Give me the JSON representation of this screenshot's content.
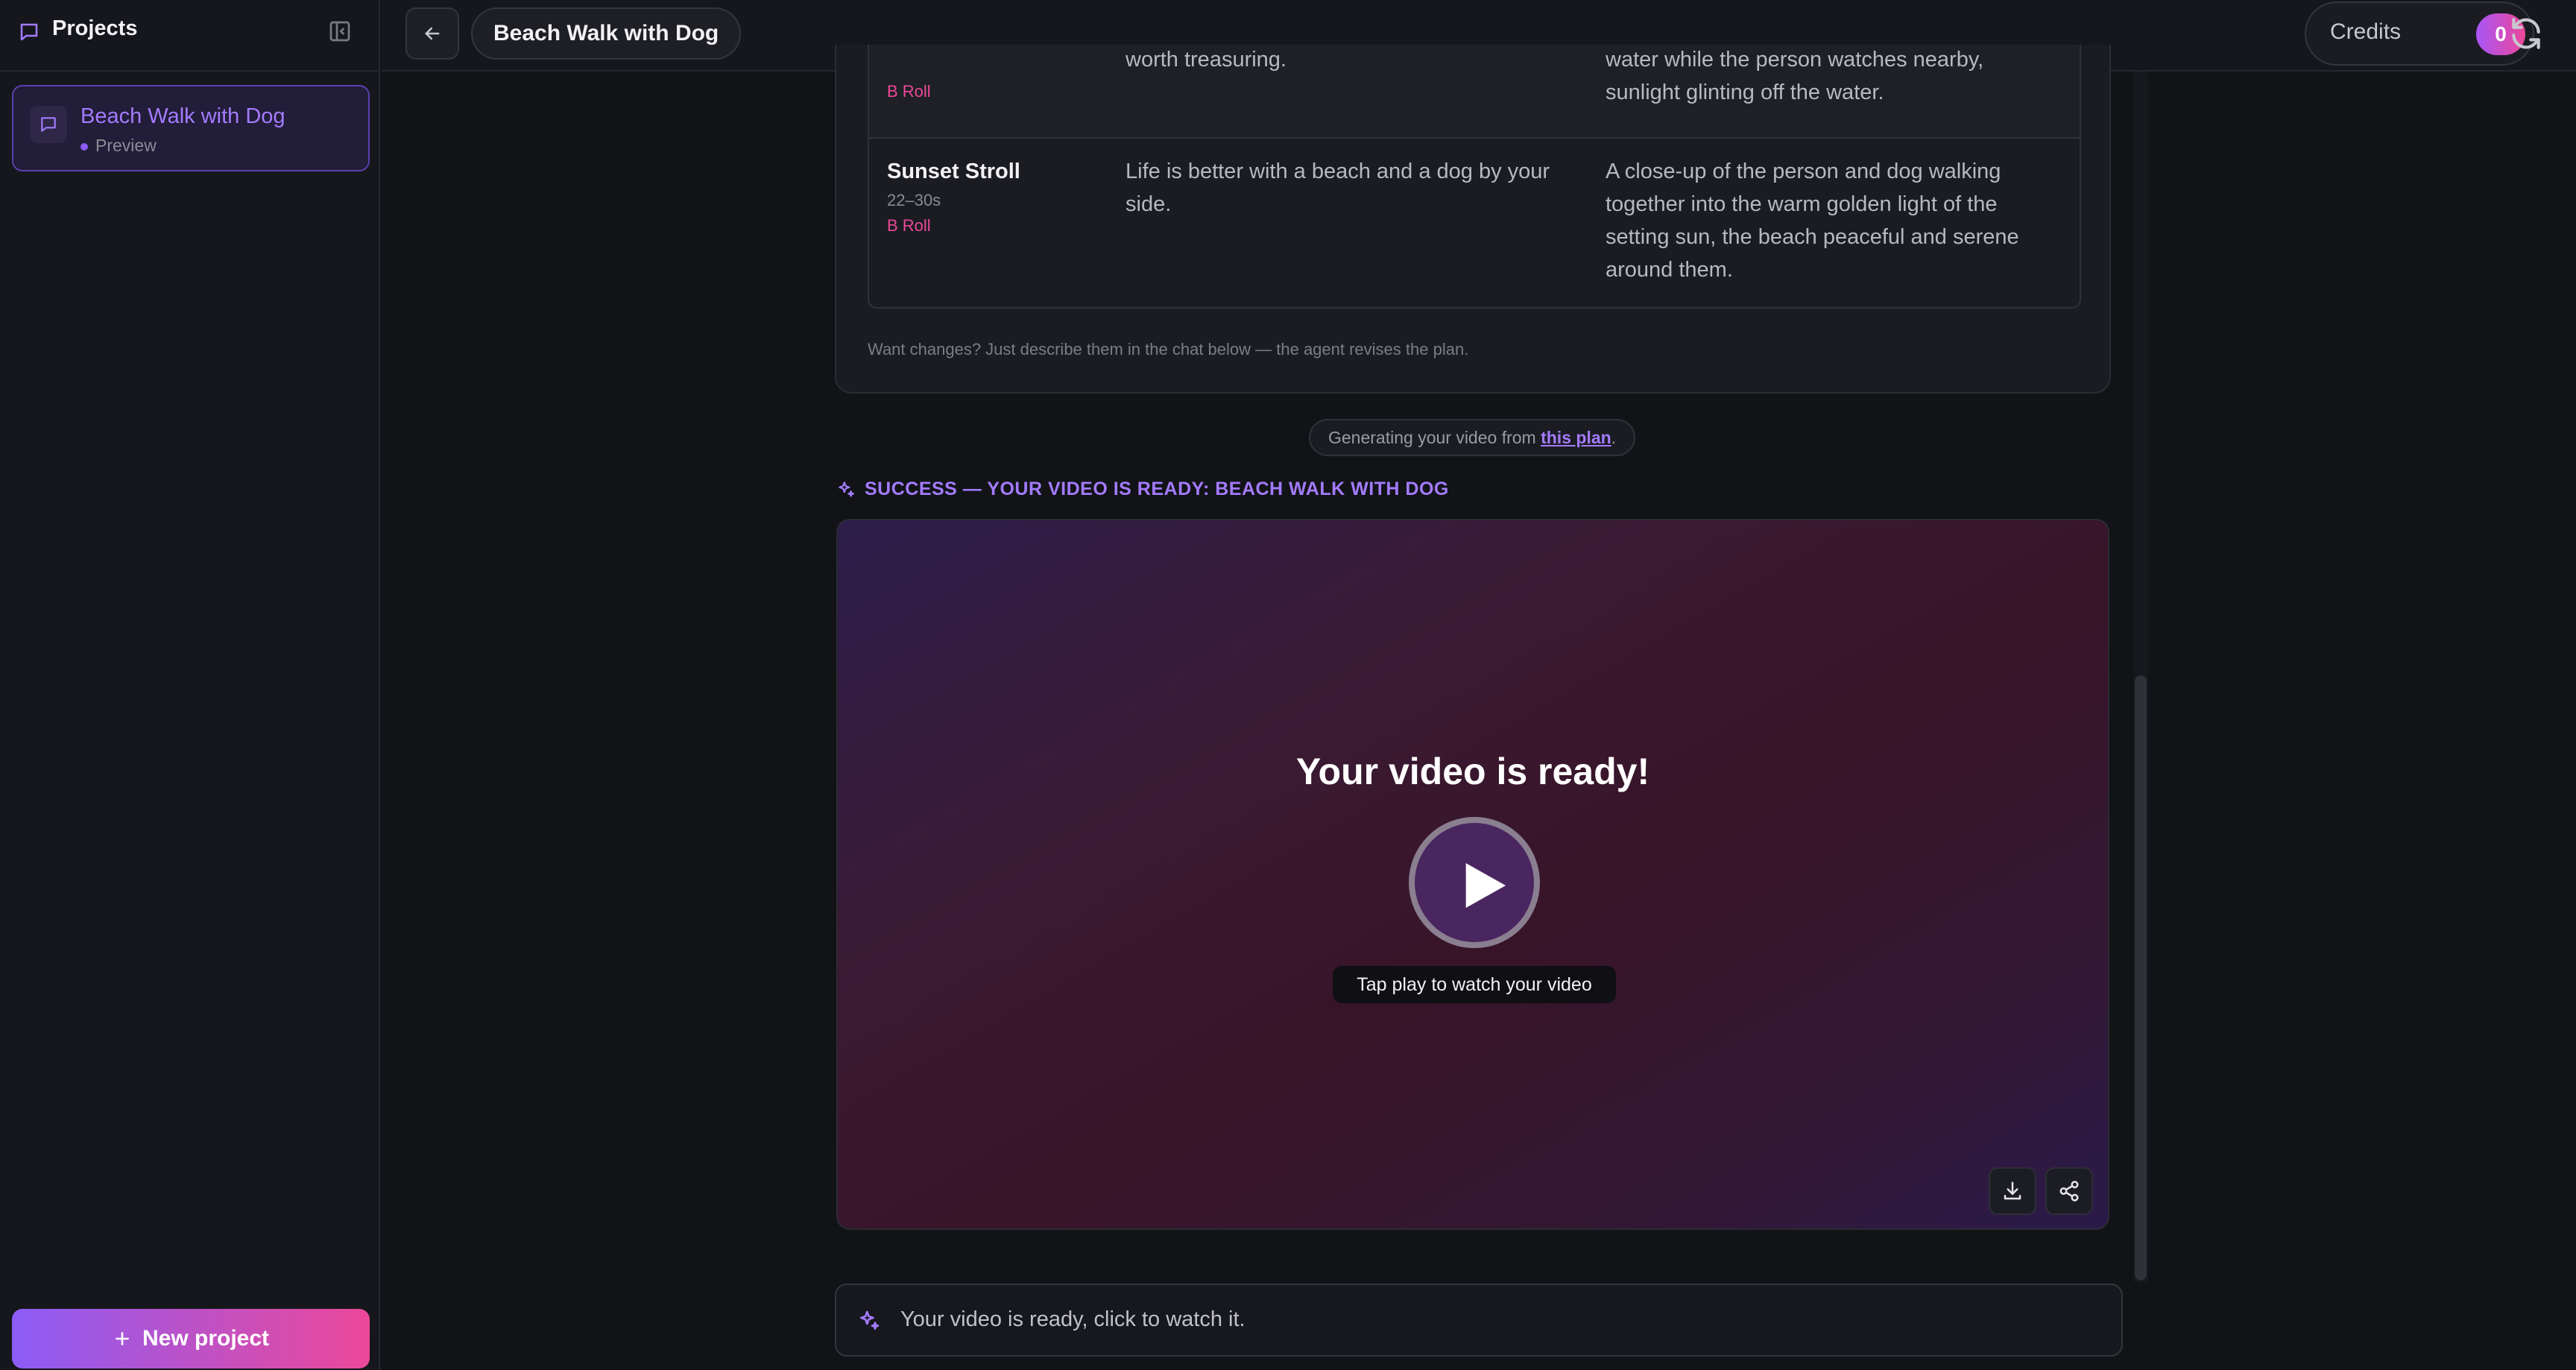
{
  "sidebar": {
    "title": "Projects",
    "project": {
      "title": "Beach Walk with Dog",
      "status": "Preview"
    },
    "new_project_label": "New project"
  },
  "topbar": {
    "project_title": "Beach Walk with Dog",
    "credits_label": "Credits",
    "credits_count": "0"
  },
  "plan": {
    "rows": [
      {
        "type": "B Roll",
        "line": "worth treasuring.",
        "visual_line1": "water while the person watches nearby,",
        "visual_line2": "sunlight glinting off the water."
      },
      {
        "name": "Sunset Stroll",
        "time": "22–30s",
        "type": "B Roll",
        "line": "Life is better with a beach and a dog by your side.",
        "visual": "A close-up of the person and dog walking together into the warm golden light of the setting sun, the beach peaceful and serene around them."
      }
    ],
    "hint": "Want changes? Just describe them in the chat below — the agent revises the plan."
  },
  "generating": {
    "prefix": "Generating your video from ",
    "link": "this plan",
    "suffix": "."
  },
  "success_text": "SUCCESS — YOUR VIDEO IS READY: BEACH WALK WITH DOG",
  "video": {
    "headline": "Your video is ready!",
    "tap_label": "Tap play to watch your video"
  },
  "chat_status": "Your video is ready, click to watch it.",
  "colors": {
    "accent": "#a37bff",
    "pink": "#ec4899",
    "background": "#121317"
  }
}
